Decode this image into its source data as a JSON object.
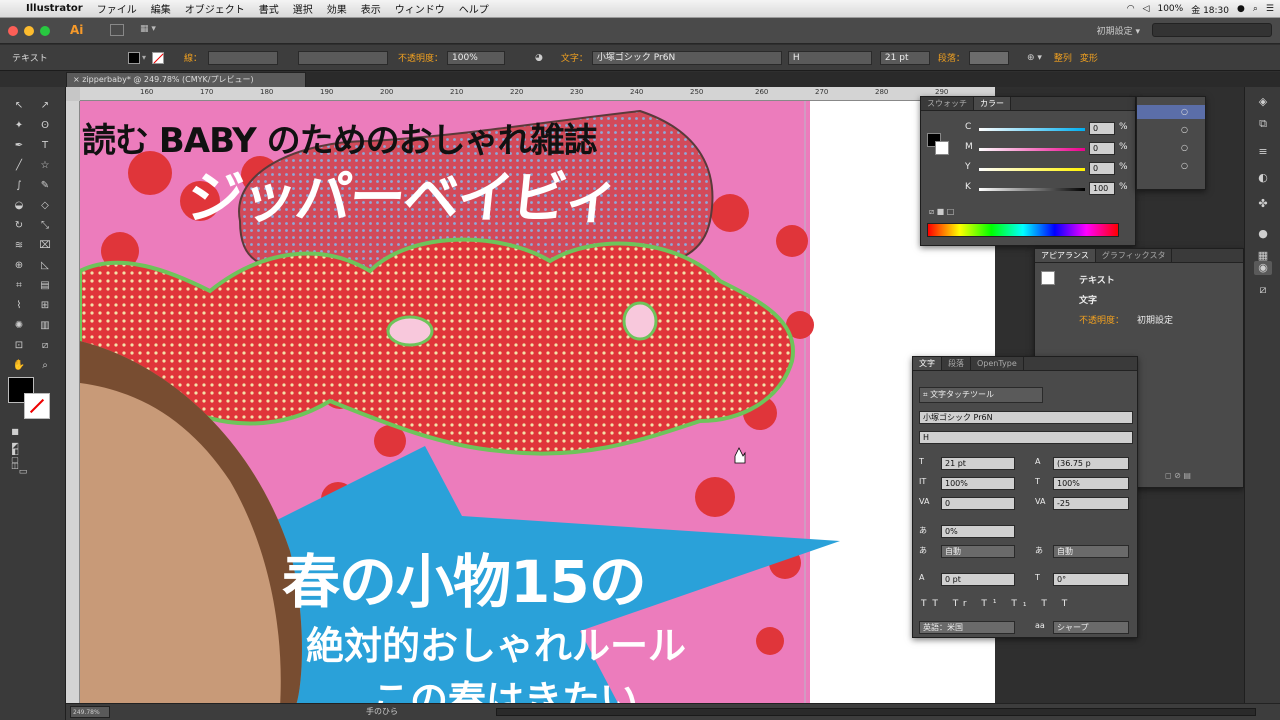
{
  "menubar": {
    "app_name": "Illustrator",
    "items": [
      "ファイル",
      "編集",
      "オブジェクト",
      "書式",
      "選択",
      "効果",
      "表示",
      "ウィンドウ",
      "ヘルプ"
    ],
    "right": {
      "battery": "100%",
      "clock": "金 18:30"
    }
  },
  "appbar": {
    "logo": "Ai",
    "workspace": "初期設定 ▾"
  },
  "control": {
    "selection_type": "テキスト",
    "stroke_label": "線：",
    "opacity_label": "不透明度：",
    "opacity_value": "100%",
    "text_label": "文字：",
    "font_family": "小塚ゴシック Pr6N",
    "font_style": "H",
    "font_size": "21 pt",
    "paragraph_label": "段落：",
    "align_label": "整列",
    "transform_label": "変形"
  },
  "document": {
    "tab_title": "zipperbaby* @ 249.78% (CMYK/プレビュー)"
  },
  "ruler": {
    "ticks": [
      "160",
      "170",
      "180",
      "190",
      "200",
      "210",
      "220",
      "230",
      "240",
      "250",
      "260",
      "270",
      "280",
      "290"
    ]
  },
  "artwork": {
    "headline": "読む BABY のためのおしゃれ雑誌",
    "title": "ジッパーベイビィ",
    "star_line1": "春の小物15の",
    "star_line2": "絶対的おしゃれルール",
    "star_line3": "この春はきたい"
  },
  "color_panel": {
    "tabs": [
      "スウォッチ",
      "カラー"
    ],
    "channels": [
      {
        "label": "C",
        "value": "0",
        "unit": "%"
      },
      {
        "label": "M",
        "value": "0",
        "unit": "%"
      },
      {
        "label": "Y",
        "value": "0",
        "unit": "%"
      },
      {
        "label": "K",
        "value": "100",
        "unit": "%"
      }
    ]
  },
  "appearance_panel": {
    "tabs": [
      "アピアランス",
      "グラフィックスタ"
    ],
    "rows": [
      "テキスト",
      "文字",
      "不透明度：",
      "初期設定"
    ]
  },
  "character_panel": {
    "tabs": [
      "文字",
      "段落",
      "OpenType"
    ],
    "touch_tool": "文字タッチツール",
    "font_family": "小塚ゴシック Pr6N",
    "font_style": "H",
    "size": "21 pt",
    "leading": "(36.75 p",
    "vscale": "100%",
    "hscale": "100%",
    "kerning": "0",
    "tracking": "-25",
    "tsume": "0%",
    "aki_left": "自動",
    "aki_right": "自動",
    "baseline": "0 pt",
    "rotation": "0°",
    "language": "英語：米国",
    "antialias": "シャープ"
  },
  "status": {
    "zoom": "249.78%",
    "tool": "手のひら"
  }
}
